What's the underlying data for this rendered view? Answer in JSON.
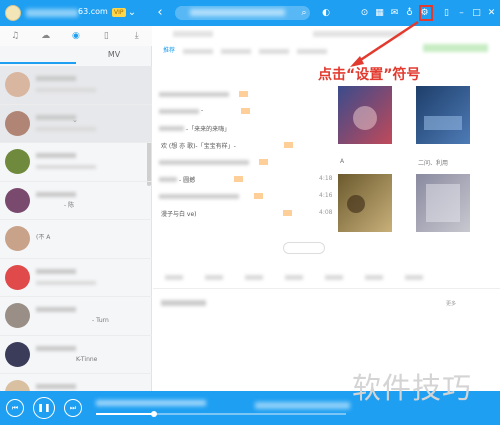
{
  "titlebar": {
    "account_suffix": "63.com",
    "vip_badge": "VIP",
    "back_icon": "back-icon",
    "search_icon": "search-icon",
    "mic_icon": "mic-icon",
    "right_icons": [
      "play-circle-icon",
      "grid-icon",
      "mail-icon",
      "shirt-icon",
      "settings-icon"
    ],
    "window_icons": [
      "mini-icon",
      "minimize-icon",
      "maximize-icon",
      "close-icon"
    ]
  },
  "sidebar": {
    "nav_icons": [
      "music-note-icon",
      "cloud-icon",
      "radio-icon",
      "mobile-icon",
      "download-icon"
    ],
    "tabs": [
      "",
      "MV"
    ],
    "rows": [
      {
        "text": ""
      },
      {
        "text": ""
      },
      {
        "text": ""
      },
      {
        "text": "- 陈"
      },
      {
        "text": "(不 A"
      },
      {
        "text": ""
      },
      {
        "text": "- Turn"
      },
      {
        "text": "K-Tinne"
      },
      {
        "text": ""
      }
    ]
  },
  "main": {
    "tab_active": "推荐",
    "more_label": "更多",
    "songs": [
      {
        "title": "",
        "dur": ""
      },
      {
        "title": "-",
        "dur": ""
      },
      {
        "title": "-「来来的来嗨」",
        "dur": ""
      },
      {
        "title": "欢 (想 亦 歌)-「宝宝有样」-",
        "dur": ""
      },
      {
        "title": "",
        "dur": ""
      },
      {
        "title": "- 圆撼",
        "dur": "4:18"
      },
      {
        "title": "",
        "dur": "4:16"
      },
      {
        "title": "漫子与白 ve)",
        "dur": "4:08"
      }
    ],
    "albums": [
      {
        "caption": "A",
        "color_a": "#3a4b8c",
        "color_b": "#c04a5a"
      },
      {
        "caption": "二问、利用",
        "color_a": "#1d3e6a",
        "color_b": "#4e7bb6"
      },
      {
        "caption": "",
        "color_a": "#6b5a2e",
        "color_b": "#c9b07a"
      },
      {
        "caption": "",
        "color_a": "#8a8aa0",
        "color_b": "#c8c8d0"
      }
    ]
  },
  "annotation": {
    "text": "点击“设置”符号",
    "color": "#e23a2e"
  },
  "player": {
    "prev_icon": "prev-icon",
    "pause_icon": "pause-icon",
    "next_icon": "next-icon",
    "progress": 0.23
  },
  "watermark": "软件技巧",
  "colors": {
    "accent": "#1e9ff2",
    "annotation_red": "#e23a2e"
  }
}
